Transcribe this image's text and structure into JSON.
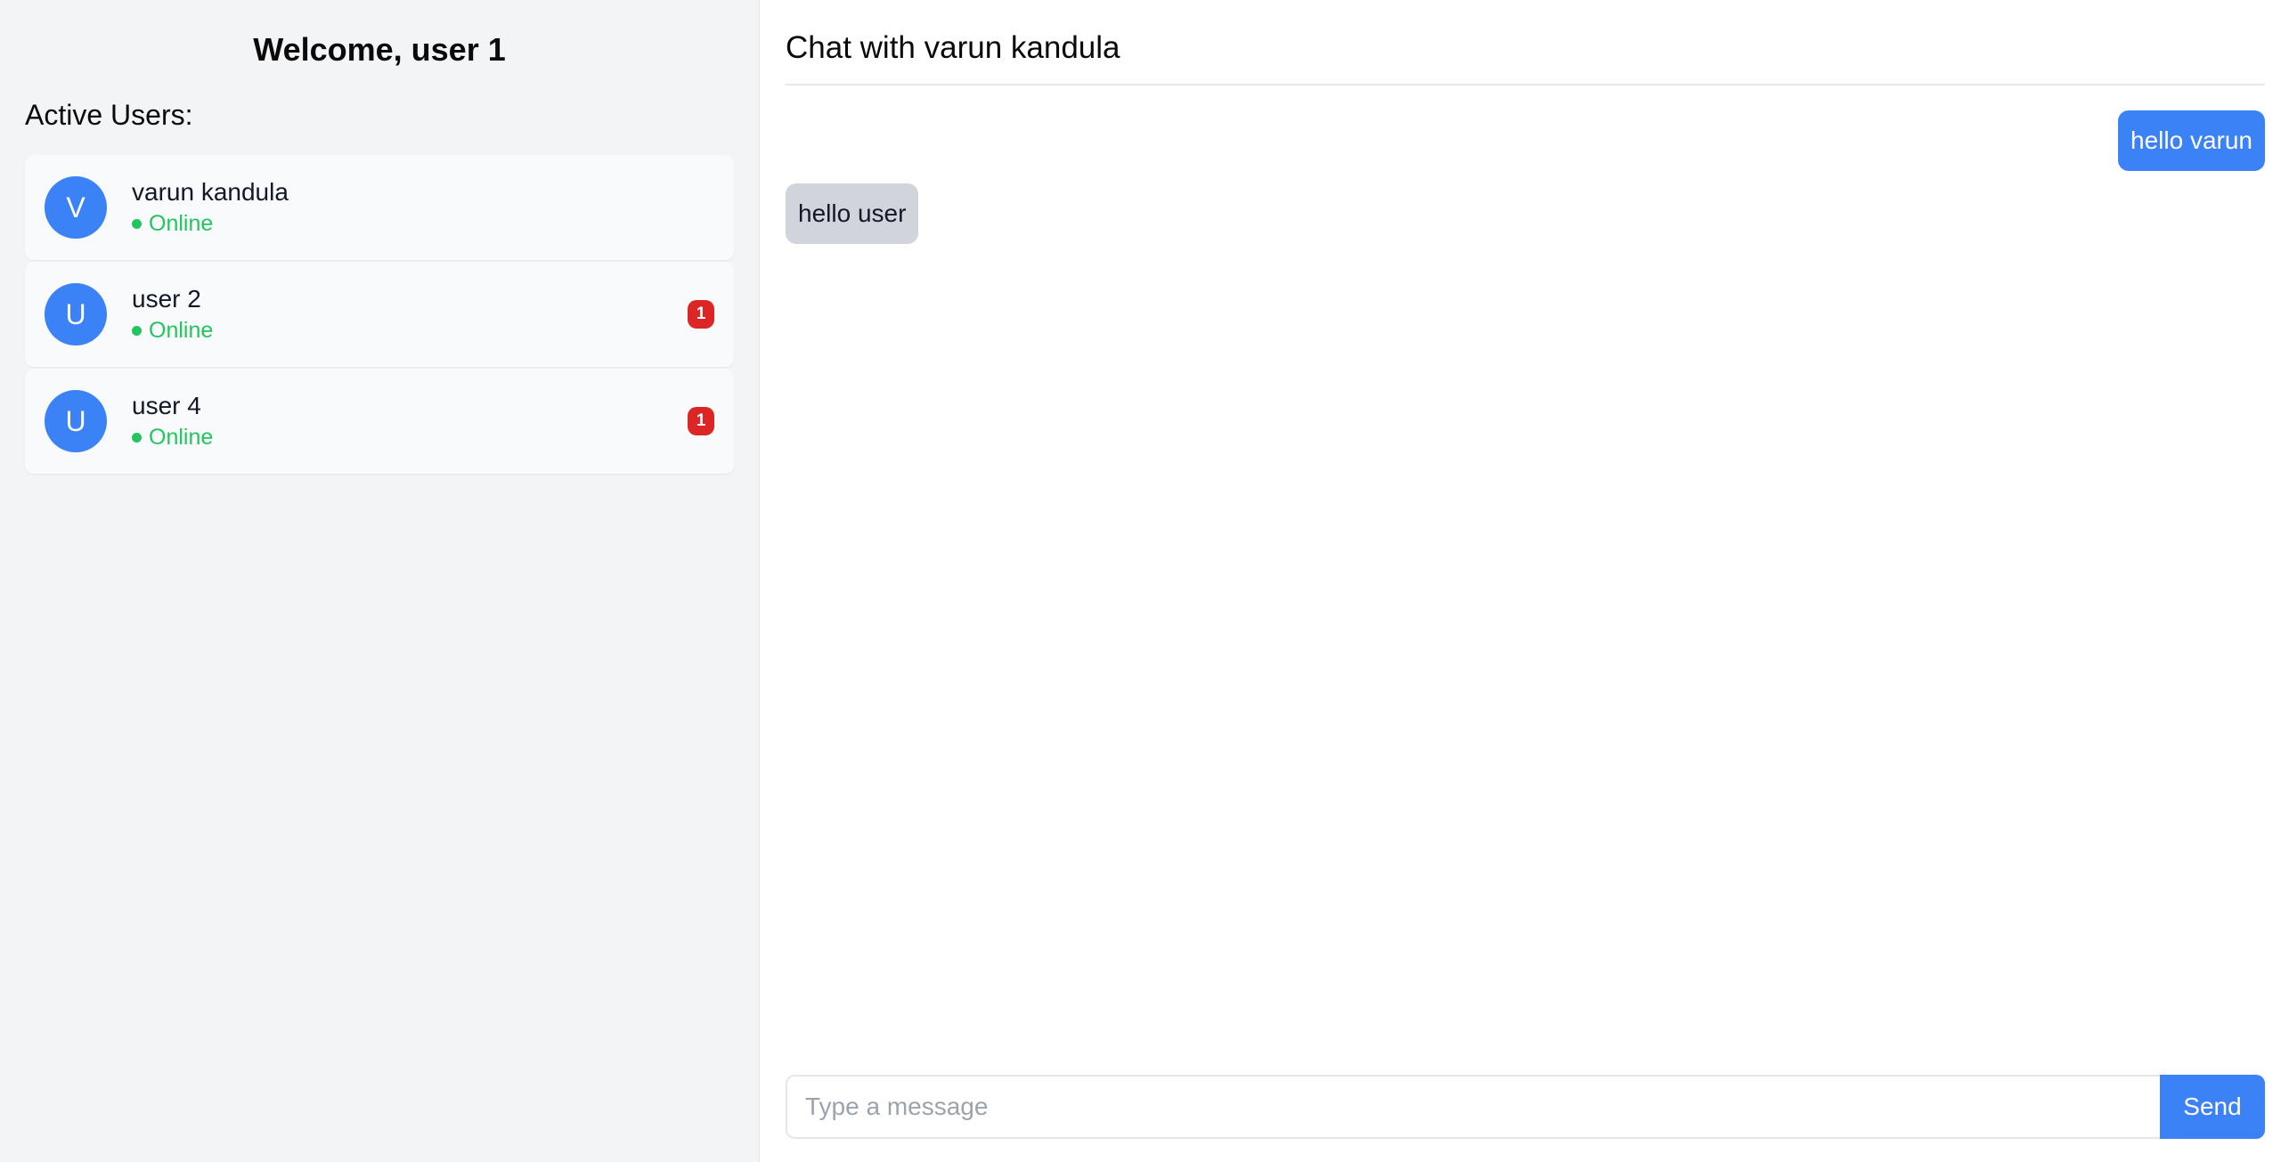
{
  "sidebar": {
    "welcome": "Welcome, user 1",
    "active_users_title": "Active Users:",
    "users": [
      {
        "initial": "V",
        "name": "varun kandula",
        "status": "Online",
        "badge": ""
      },
      {
        "initial": "U",
        "name": "user 2",
        "status": "Online",
        "badge": "1"
      },
      {
        "initial": "U",
        "name": "user 4",
        "status": "Online",
        "badge": "1"
      }
    ]
  },
  "chat": {
    "title": "Chat with varun kandula",
    "messages": [
      {
        "text": "hello varun",
        "direction": "sent"
      },
      {
        "text": "hello user",
        "direction": "received"
      }
    ],
    "input_placeholder": "Type a message",
    "input_value": "",
    "send_label": "Send"
  },
  "colors": {
    "accent": "#3b82f6",
    "online": "#22c55e",
    "badge": "#dc2626",
    "received_bubble": "#d1d5db",
    "sidebar_bg": "#f3f4f6"
  },
  "icons": {
    "status": "online-dot-icon"
  }
}
